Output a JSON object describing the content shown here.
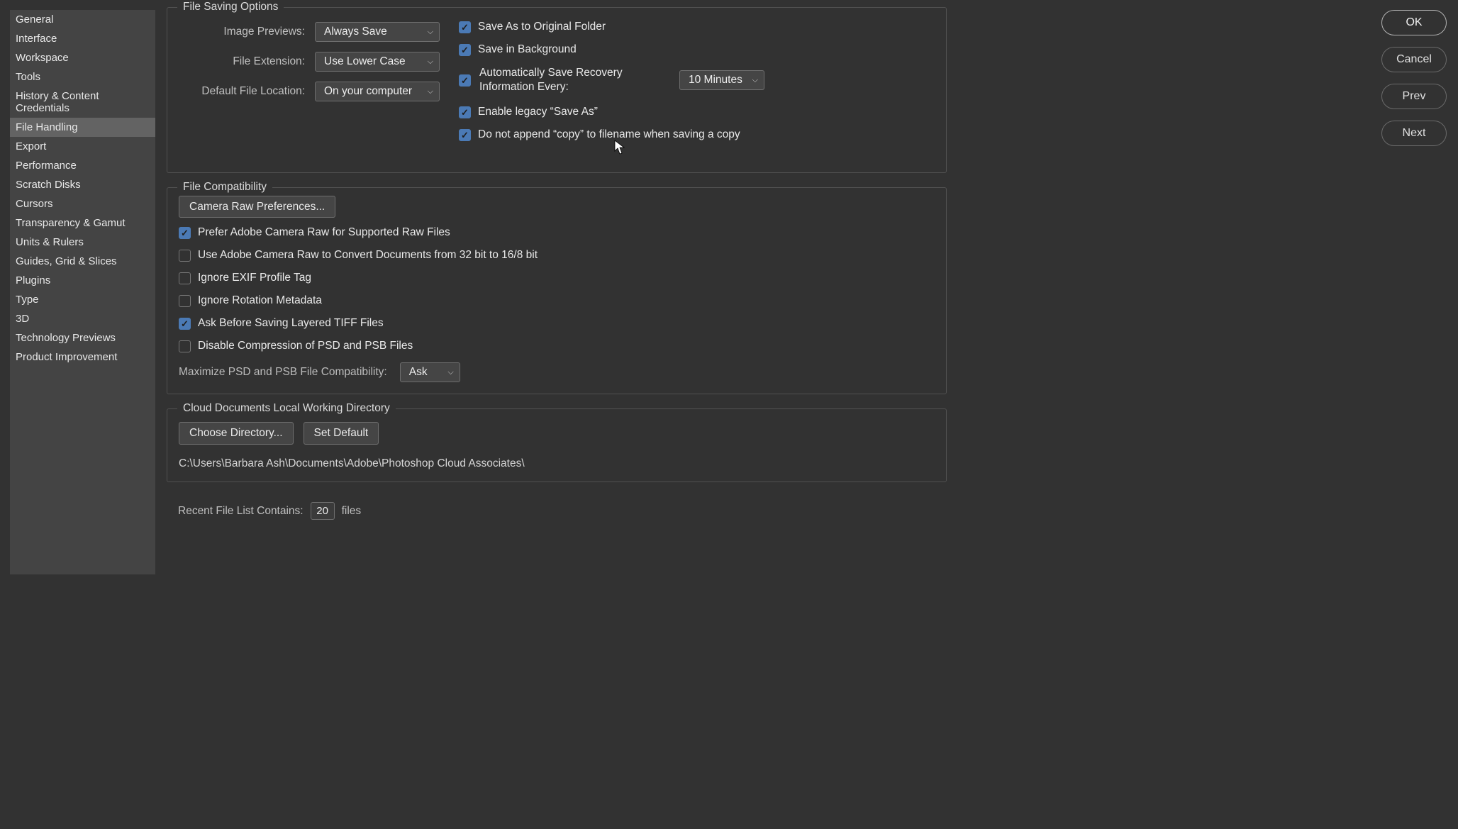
{
  "sidebar": {
    "items": [
      "General",
      "Interface",
      "Workspace",
      "Tools",
      "History & Content Credentials",
      "File Handling",
      "Export",
      "Performance",
      "Scratch Disks",
      "Cursors",
      "Transparency & Gamut",
      "Units & Rulers",
      "Guides, Grid & Slices",
      "Plugins",
      "Type",
      "3D",
      "Technology Previews",
      "Product Improvement"
    ],
    "active_index": 5
  },
  "buttons": {
    "ok": "OK",
    "cancel": "Cancel",
    "prev": "Prev",
    "next": "Next"
  },
  "file_saving": {
    "legend": "File Saving Options",
    "image_previews_label": "Image Previews:",
    "image_previews_value": "Always Save",
    "file_extension_label": "File Extension:",
    "file_extension_value": "Use Lower Case",
    "default_location_label": "Default File Location:",
    "default_location_value": "On your computer",
    "save_as_original": "Save As to Original Folder",
    "save_in_background": "Save in Background",
    "auto_save_label": "Automatically Save Recovery Information Every:",
    "auto_save_interval": "10 Minutes",
    "enable_legacy_save_as": "Enable legacy “Save As”",
    "no_append_copy": "Do not append “copy” to filename when saving a copy"
  },
  "file_compat": {
    "legend": "File Compatibility",
    "camera_raw_prefs": "Camera Raw Preferences...",
    "prefer_acr": "Prefer Adobe Camera Raw for Supported Raw Files",
    "acr_convert_32": "Use Adobe Camera Raw to Convert Documents from 32 bit to 16/8 bit",
    "ignore_exif": "Ignore EXIF Profile Tag",
    "ignore_rotation": "Ignore Rotation Metadata",
    "ask_tiff": "Ask Before Saving Layered TIFF Files",
    "disable_compression": "Disable Compression of PSD and PSB Files",
    "max_compat_label": "Maximize PSD and PSB File Compatibility:",
    "max_compat_value": "Ask"
  },
  "cloud": {
    "legend": "Cloud Documents Local Working Directory",
    "choose": "Choose Directory...",
    "set_default": "Set Default",
    "path": "C:\\Users\\Barbara Ash\\Documents\\Adobe\\Photoshop Cloud Associates\\"
  },
  "recent": {
    "label": "Recent File List Contains:",
    "value": "20",
    "suffix": "files"
  }
}
